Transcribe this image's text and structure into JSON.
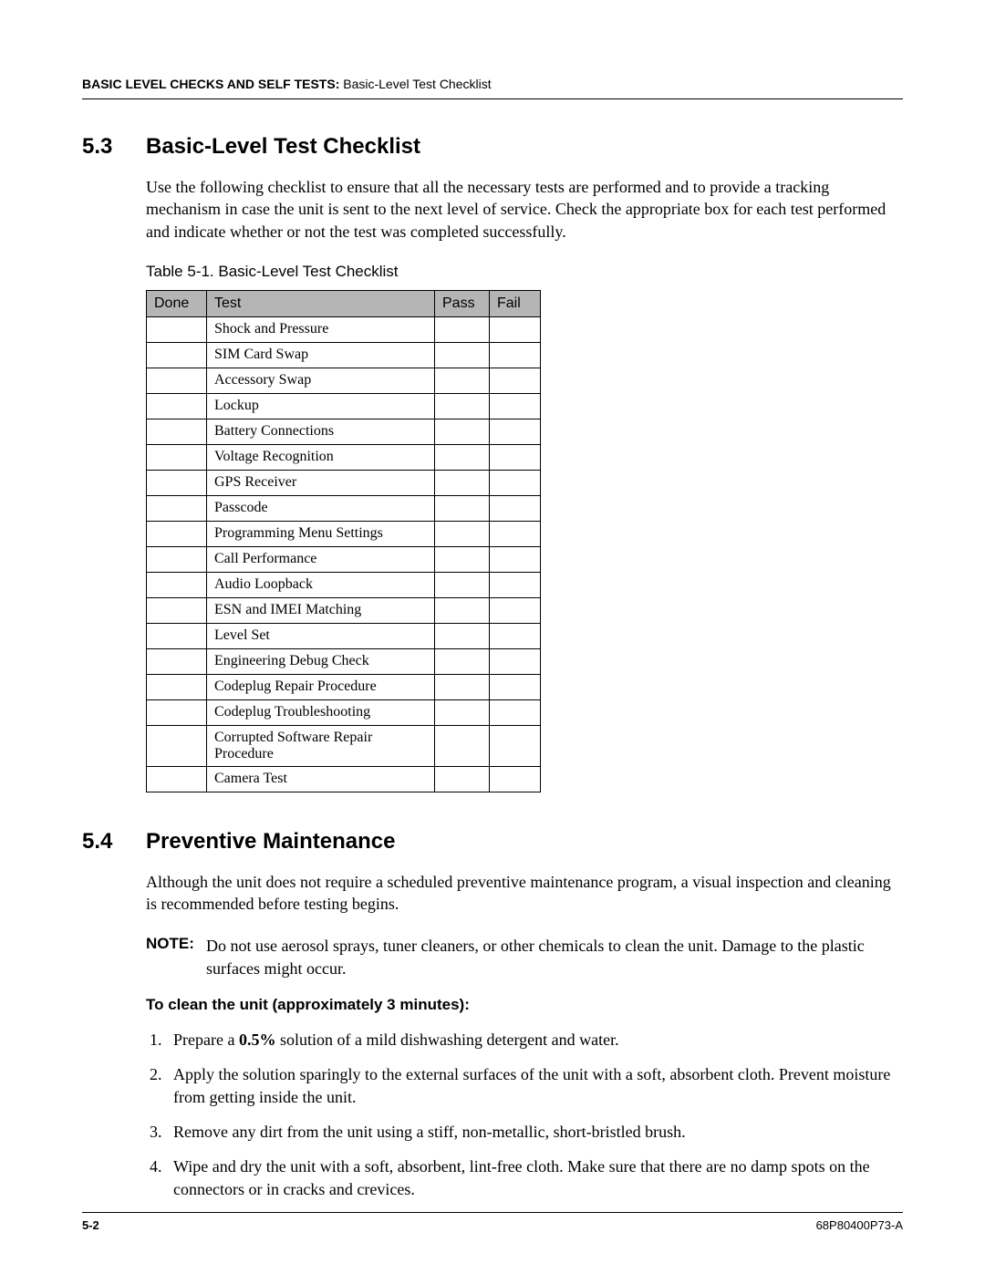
{
  "header": {
    "bold": "BASIC LEVEL CHECKS AND SELF TESTS:",
    "rest": " Basic-Level Test Checklist"
  },
  "section53": {
    "num": "5.3",
    "title": "Basic-Level Test Checklist",
    "intro": "Use the following checklist to ensure that all the necessary tests are performed and to provide a tracking mechanism in case the unit is sent to the next level of service. Check the appropriate box for each test performed and indicate whether or not the test was completed successfully.",
    "tableCaption": "Table 5-1.  Basic-Level Test Checklist",
    "cols": {
      "done": "Done",
      "test": "Test",
      "pass": "Pass",
      "fail": "Fail"
    },
    "tests": [
      "Shock and Pressure",
      "SIM Card Swap",
      "Accessory Swap",
      "Lockup",
      "Battery Connections",
      "Voltage Recognition",
      "GPS Receiver",
      "Passcode",
      "Programming Menu Settings",
      "Call Performance",
      "Audio Loopback",
      "ESN and IMEI Matching",
      "Level Set",
      "Engineering Debug Check",
      "Codeplug Repair Procedure",
      "Codeplug Troubleshooting",
      "Corrupted Software Repair Procedure",
      "Camera Test"
    ]
  },
  "section54": {
    "num": "5.4",
    "title": "Preventive Maintenance",
    "intro": "Although the unit does not require a scheduled preventive maintenance program, a visual inspection and cleaning is recommended before testing begins.",
    "noteLabel": "NOTE:",
    "noteText": "Do not use aerosol sprays, tuner cleaners, or other chemicals to clean the unit. Damage to the plastic surfaces might occur.",
    "subhead": "To clean the unit (approximately 3 minutes):",
    "step1_pre": "Prepare a ",
    "step1_bold": "0.5%",
    "step1_post": " solution of a mild dishwashing detergent and water.",
    "steps_rest": [
      "Apply the solution sparingly to the external surfaces of the unit with a soft, absorbent cloth. Prevent moisture from getting inside the unit.",
      "Remove any dirt from the unit using a stiff, non-metallic, short-bristled brush.",
      "Wipe and dry the unit with a soft, absorbent, lint-free cloth. Make sure that there are no damp spots on the connectors or in cracks and crevices."
    ]
  },
  "footer": {
    "left": "5-2",
    "right": "68P80400P73-A"
  }
}
